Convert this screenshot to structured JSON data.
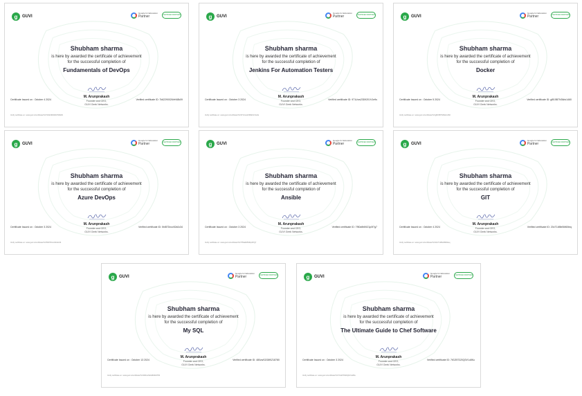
{
  "brand": {
    "logo_text": "GUVI",
    "logo_mark": "g"
  },
  "partner": {
    "small": "Google for Education",
    "big": "Partner",
    "badge": "CERTIFIED PARTNER"
  },
  "certificates": [
    {
      "name": "Shubham sharma",
      "line1": "is here by awarded the certificate of achievement",
      "line2": "for the successful completion of",
      "course": "Fundamentals of DevOps",
      "signer": "M. Arunprakash",
      "role": "Founder and CEO,",
      "org": "GUVI Geek Networks.",
      "issued": "Certificate Issued on : October 4 2024",
      "verified": "Verified certificate ID: 7k62290026IrH48k09",
      "verify": "Verify certificate at : www.guvi.in/certificate?id=7k62290026IrH48k09"
    },
    {
      "name": "Shubham sharma",
      "line1": "is here by awarded the certificate of achievement",
      "line2": "for the successful completion of",
      "course": "Jenkins For Automation Testers",
      "signer": "M. Arunprakash",
      "role": "Founder and CEO,",
      "org": "GUVI Geek Networks.",
      "issued": "Certificate Issued on : October 3 2024",
      "verified": "Verified certificate ID: 971Uvw23D9201V1e9s",
      "verify": "Verify certificate at : www.guvi.in/certificate?id=971Uvw23D9201V1e9s"
    },
    {
      "name": "Shubham sharma",
      "line1": "is here by awarded the certificate of achievement",
      "line2": "for the successful completion of",
      "course": "Docker",
      "signer": "M. Arunprakash",
      "role": "Founder and CEO,",
      "org": "GUVI Geek Networks.",
      "issued": "Certificate Issued on : October 5 2024",
      "verified": "Verified certificate ID: g8l15B7N36dv1460",
      "verify": "Verify certificate at : www.guvi.in/certificate?id=g8l15B7N36dv1460"
    },
    {
      "name": "Shubham sharma",
      "line1": "is here by awarded the certificate of achievement",
      "line2": "for the successful completion of",
      "course": "Azure DevOps",
      "signer": "M. Arunprakash",
      "role": "Founder and CEO,",
      "org": "GUVI Geek Networks.",
      "issued": "Certificate Issued on : October 3 2024",
      "verified": "Verified certificate ID: 5hl87Dnov52s0c34",
      "verify": "Verify certificate at : www.guvi.in/certificate?id=5hl87Dnov52s0c34"
    },
    {
      "name": "Shubham sharma",
      "line1": "is here by awarded the certificate of achievement",
      "line2": "for the successful completion of",
      "course": "Ansible",
      "signer": "M. Arunprakash",
      "role": "Founder and CEO,",
      "org": "GUVI Geek Networks.",
      "issued": "Certificate Issued on : October 3 2024",
      "verified": "Verified certificate ID: 7f50a9b59Z1p0f7g7",
      "verify": "Verify certificate at : www.guvi.in/certificate?id=7f50a9b59Z1p0f7g7"
    },
    {
      "name": "Shubham sharma",
      "line1": "is here by awarded the certificate of achievement",
      "line2": "for the successful completion of",
      "course": "GIT",
      "signer": "M. Arunprakash",
      "role": "Founder and CEO,",
      "org": "GUVI Geek Networks.",
      "issued": "Certificate Issued on : October 4 2024",
      "verified": "Verified certificate ID: 20cT14f8e5M60teq",
      "verify": "Verify certificate at : www.guvi.in/certificate?id=20cT14f8e5M60teq"
    },
    {
      "name": "Shubham sharma",
      "line1": "is here by awarded the certificate of achievement",
      "line2": "for the successful completion of",
      "course": "My SQL",
      "signer": "M. Arunprakash",
      "role": "Founder and CEO,",
      "org": "GUVI Geek Networks.",
      "issued": "Certificate Issued on : October 13 2024",
      "verified": "Verified certificate ID: 480zwS2G8f0Z18780",
      "verify": "Verify certificate at : www.guvi.in/certificate?id=480zwS2G8f0Z18780"
    },
    {
      "name": "Shubham sharma",
      "line1": "is here by awarded the certificate of achievement",
      "line2": "for the successful completion of",
      "course": "The Ultimate Guide to Chef Software",
      "signer": "M. Arunprakash",
      "role": "Founder and CEO,",
      "org": "GUVI Geek Networks.",
      "issued": "Certificate Issued on : October 3 2024",
      "verified": "Verified certificate ID: 7tG257D20Q0V1o8Ku",
      "verify": "Verify certificate at : www.guvi.in/certificate?id=7tG257D20Q0V1o8Ku"
    }
  ]
}
